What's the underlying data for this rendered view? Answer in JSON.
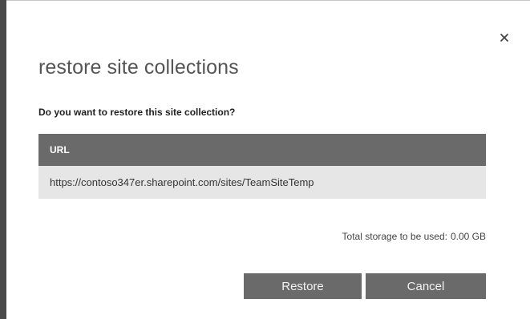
{
  "dialog": {
    "title": "restore site collections",
    "close_icon": "close-icon",
    "question": "Do you want to restore this site collection?",
    "table": {
      "header": "URL",
      "rows": [
        "https://contoso347er.sharepoint.com/sites/TeamSiteTemp"
      ]
    },
    "storage": {
      "label": "Total storage to be used:",
      "value": "0.00 GB"
    },
    "buttons": {
      "restore": "Restore",
      "cancel": "Cancel"
    }
  },
  "colors": {
    "header_bg": "#6a6a6a",
    "row_bg": "#e6e6e6",
    "button_bg": "#6a6a6a",
    "title_text": "#555555"
  }
}
